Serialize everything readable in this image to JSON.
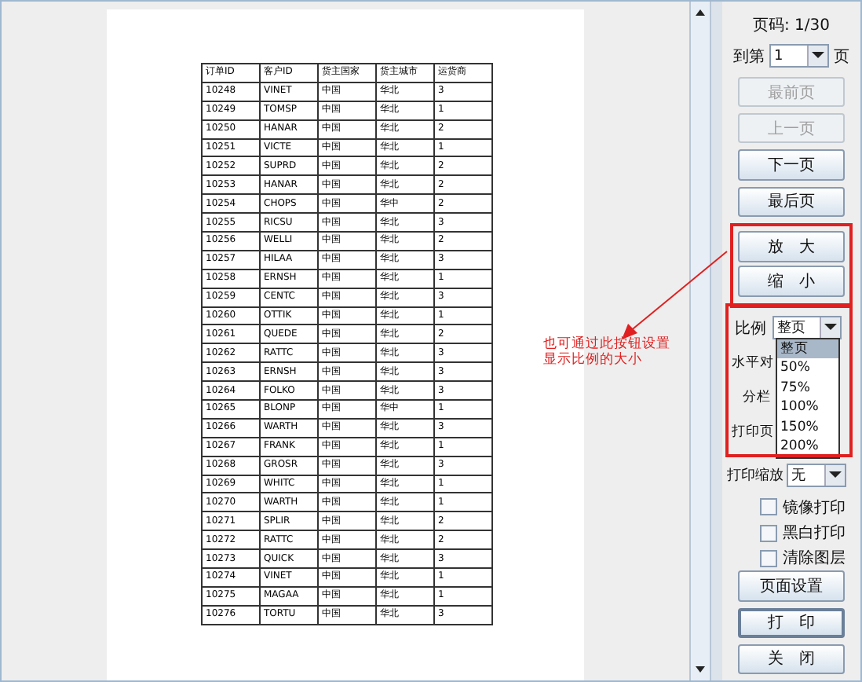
{
  "preview": {
    "table": {
      "columns": [
        "订单ID",
        "客户ID",
        "货主国家",
        "货主城市",
        "运货商"
      ],
      "rows": [
        [
          "10248",
          "VINET",
          "中国",
          "华北",
          "3"
        ],
        [
          "10249",
          "TOMSP",
          "中国",
          "华北",
          "1"
        ],
        [
          "10250",
          "HANAR",
          "中国",
          "华北",
          "2"
        ],
        [
          "10251",
          "VICTE",
          "中国",
          "华北",
          "1"
        ],
        [
          "10252",
          "SUPRD",
          "中国",
          "华北",
          "2"
        ],
        [
          "10253",
          "HANAR",
          "中国",
          "华北",
          "2"
        ],
        [
          "10254",
          "CHOPS",
          "中国",
          "华中",
          "2"
        ],
        [
          "10255",
          "RICSU",
          "中国",
          "华北",
          "3"
        ],
        [
          "10256",
          "WELLI",
          "中国",
          "华北",
          "2"
        ],
        [
          "10257",
          "HILAA",
          "中国",
          "华北",
          "3"
        ],
        [
          "10258",
          "ERNSH",
          "中国",
          "华北",
          "1"
        ],
        [
          "10259",
          "CENTC",
          "中国",
          "华北",
          "3"
        ],
        [
          "10260",
          "OTTIK",
          "中国",
          "华北",
          "1"
        ],
        [
          "10261",
          "QUEDE",
          "中国",
          "华北",
          "2"
        ],
        [
          "10262",
          "RATTC",
          "中国",
          "华北",
          "3"
        ],
        [
          "10263",
          "ERNSH",
          "中国",
          "华北",
          "3"
        ],
        [
          "10264",
          "FOLKO",
          "中国",
          "华北",
          "3"
        ],
        [
          "10265",
          "BLONP",
          "中国",
          "华中",
          "1"
        ],
        [
          "10266",
          "WARTH",
          "中国",
          "华北",
          "3"
        ],
        [
          "10267",
          "FRANK",
          "中国",
          "华北",
          "1"
        ],
        [
          "10268",
          "GROSR",
          "中国",
          "华北",
          "3"
        ],
        [
          "10269",
          "WHITC",
          "中国",
          "华北",
          "1"
        ],
        [
          "10270",
          "WARTH",
          "中国",
          "华北",
          "1"
        ],
        [
          "10271",
          "SPLIR",
          "中国",
          "华北",
          "2"
        ],
        [
          "10272",
          "RATTC",
          "中国",
          "华北",
          "2"
        ],
        [
          "10273",
          "QUICK",
          "中国",
          "华北",
          "3"
        ],
        [
          "10274",
          "VINET",
          "中国",
          "华北",
          "1"
        ],
        [
          "10275",
          "MAGAA",
          "中国",
          "华北",
          "1"
        ],
        [
          "10276",
          "TORTU",
          "中国",
          "华北",
          "3"
        ]
      ]
    }
  },
  "annotation": "也可通过此按钮设置显示比例的大小",
  "panel": {
    "page_label": "页码: 1/30",
    "goto_label": "到第",
    "goto_value": "1",
    "goto_suffix": "页",
    "nav_buttons": [
      {
        "label": "最前页",
        "disabled": true
      },
      {
        "label": "上一页",
        "disabled": true
      },
      {
        "label": "下一页",
        "disabled": false
      },
      {
        "label": "最后页",
        "disabled": false
      }
    ],
    "zoom_buttons": [
      "放　大",
      "缩　小"
    ],
    "scale_label": "比例",
    "scale_value": "整页",
    "scale_options": [
      {
        "label": "整页",
        "selected": true
      },
      {
        "label": "50%",
        "selected": false
      },
      {
        "label": "75%",
        "selected": false
      },
      {
        "label": "100%",
        "selected": false
      },
      {
        "label": "150%",
        "selected": false
      },
      {
        "label": "200%",
        "selected": false
      }
    ],
    "align_label": "水平对",
    "columns_label": "分栏",
    "print_pages_label": "打印页",
    "print_scale_label": "打印缩放",
    "print_scale_value": "无",
    "checkboxes": [
      {
        "label": "镜像打印",
        "checked": false
      },
      {
        "label": "黑白打印",
        "checked": false
      },
      {
        "label": "清除图层",
        "checked": false
      }
    ],
    "bottom_buttons": [
      "页面设置",
      "打　印",
      "关　闭"
    ]
  }
}
